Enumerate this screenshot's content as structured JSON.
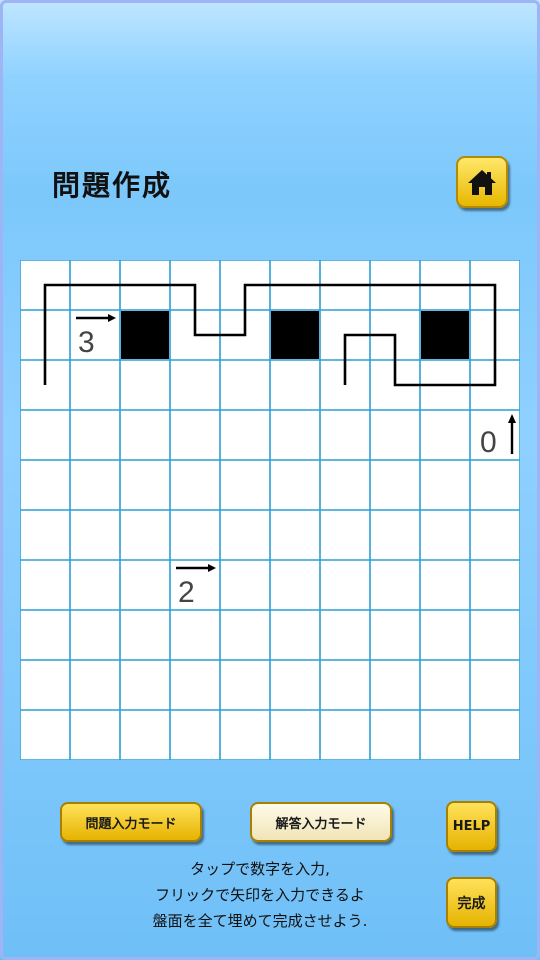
{
  "header": {
    "title": "問題作成",
    "home_icon": "home-icon"
  },
  "board": {
    "rows": 10,
    "cols": 10,
    "grid_color": "#2a9fd6",
    "filled_cells": [
      [
        1,
        2
      ],
      [
        1,
        5
      ],
      [
        1,
        8
      ]
    ],
    "clues": [
      {
        "row": 1,
        "col": 1,
        "value": "3",
        "arrow": "right"
      },
      {
        "row": 3,
        "col": 9,
        "value": "0",
        "arrow": "up"
      },
      {
        "row": 6,
        "col": 3,
        "value": "2",
        "arrow": "right"
      }
    ],
    "path_points": [
      [
        0.5,
        2.5
      ],
      [
        0.5,
        0.5
      ],
      [
        3.5,
        0.5
      ],
      [
        3.5,
        1.5
      ],
      [
        4.5,
        1.5
      ],
      [
        4.5,
        0.5
      ],
      [
        9.5,
        0.5
      ],
      [
        9.5,
        2.5
      ],
      [
        7.5,
        2.5
      ],
      [
        7.5,
        1.5
      ],
      [
        6.5,
        1.5
      ],
      [
        6.5,
        2.5
      ]
    ]
  },
  "buttons": {
    "problem_mode": "問題入力モード",
    "answer_mode": "解答入力モード",
    "help": "HELP",
    "complete": "完成"
  },
  "instructions": {
    "line1": "タップで数字を入力,",
    "line2": "フリックで矢印を入力できるよ",
    "line3": "盤面を全て埋めて完成させよう."
  }
}
